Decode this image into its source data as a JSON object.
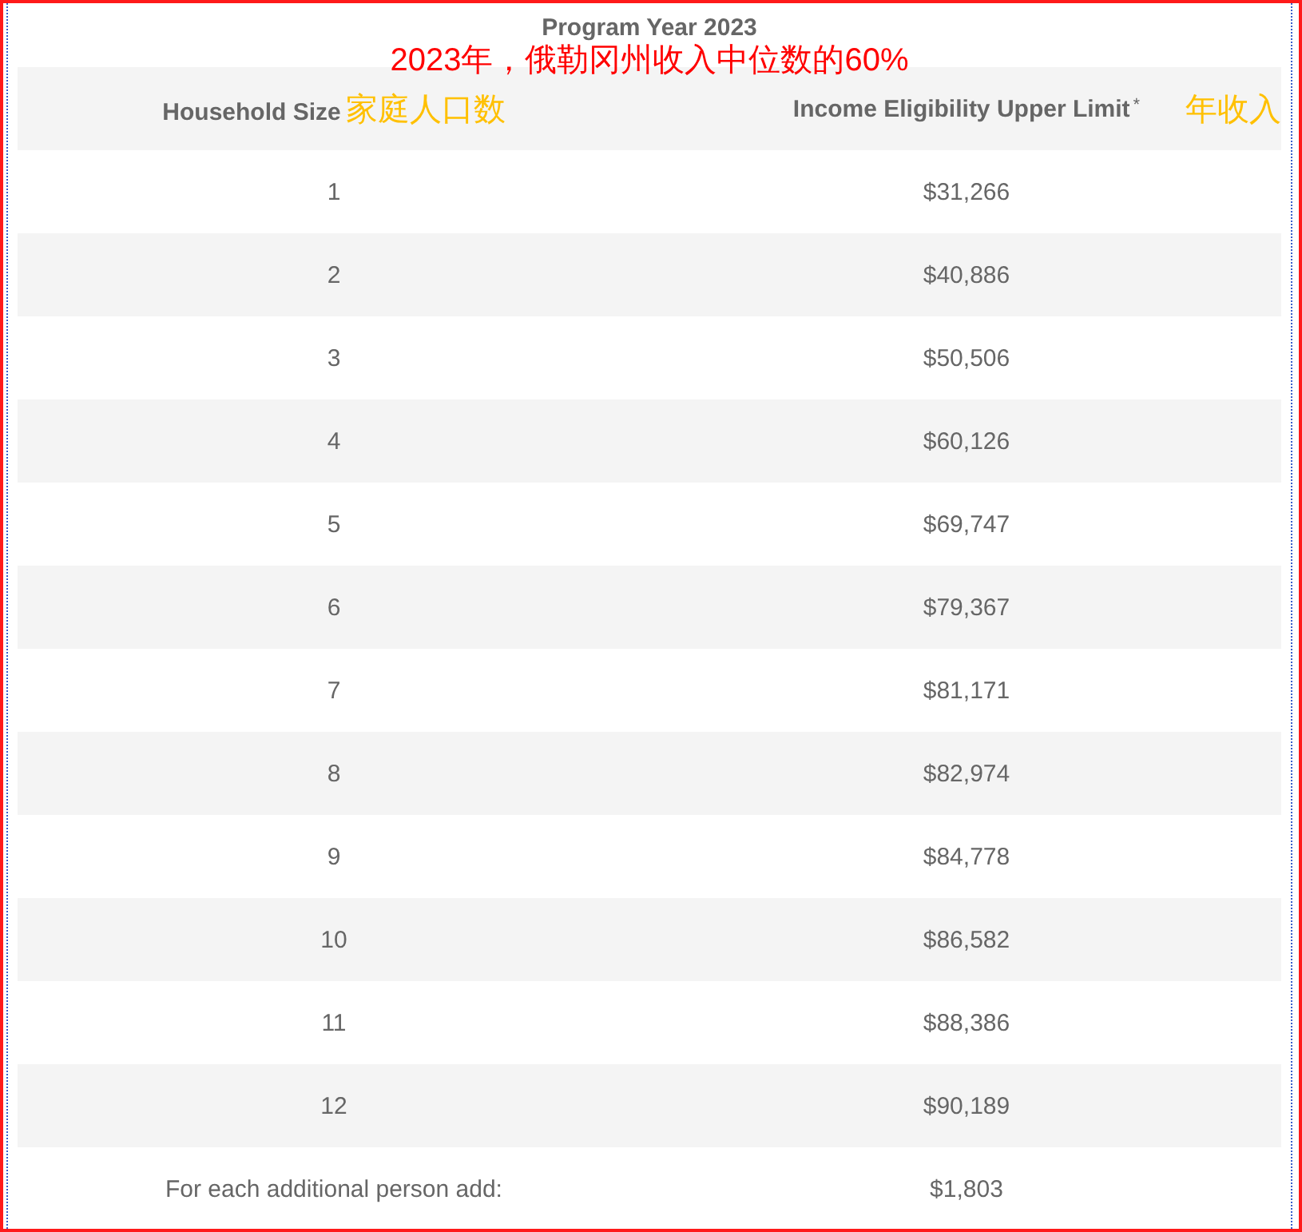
{
  "title": "Program Year 2023",
  "title_note": {
    "text": "2023年，俄勒冈州收入中位数的60%",
    "color": "#ff0000"
  },
  "columns": [
    {
      "label": "Household Size",
      "note": {
        "text": "家庭人口数",
        "color": "#ffc000"
      }
    },
    {
      "label": "Income Eligibility Upper Limit",
      "mark": "*",
      "note": {
        "text": "年收入",
        "color": "#ffc000"
      }
    }
  ],
  "rows": [
    [
      "1",
      "$31,266"
    ],
    [
      "2",
      "$40,886"
    ],
    [
      "3",
      "$50,506"
    ],
    [
      "4",
      "$60,126"
    ],
    [
      "5",
      "$69,747"
    ],
    [
      "6",
      "$79,367"
    ],
    [
      "7",
      "$81,171"
    ],
    [
      "8",
      "$82,974"
    ],
    [
      "9",
      "$84,778"
    ],
    [
      "10",
      "$86,582"
    ],
    [
      "11",
      "$88,386"
    ],
    [
      "12",
      "$90,189"
    ]
  ],
  "footer": [
    "For each additional person add:",
    "$1,803"
  ]
}
